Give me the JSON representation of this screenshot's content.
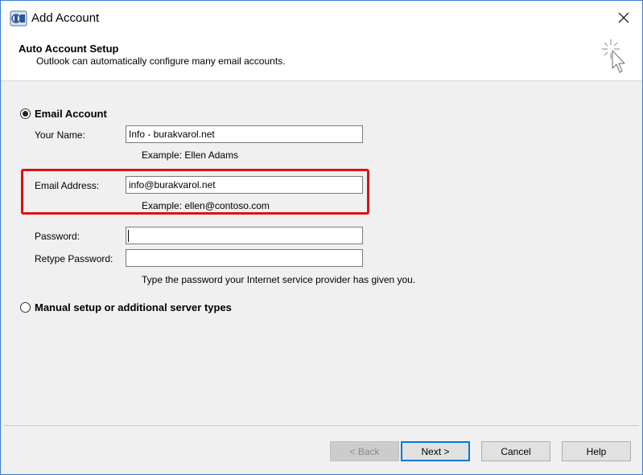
{
  "window": {
    "title": "Add Account",
    "close_glyph": "✕"
  },
  "header": {
    "title": "Auto Account Setup",
    "subtitle": "Outlook can automatically configure many email accounts."
  },
  "options": {
    "email_account": {
      "label": "Email Account",
      "selected": true
    },
    "manual_setup": {
      "label": "Manual setup or additional server types",
      "selected": false
    }
  },
  "form": {
    "name": {
      "label": "Your Name:",
      "value": "Info - burakvarol.net",
      "example": "Example: Ellen Adams"
    },
    "email": {
      "label": "Email Address:",
      "value": "info@burakvarol.net",
      "example": "Example: ellen@contoso.com"
    },
    "password": {
      "label": "Password:",
      "value": ""
    },
    "retype_password": {
      "label": "Retype Password:",
      "value": ""
    },
    "password_hint": "Type the password your Internet service provider has given you."
  },
  "buttons": {
    "back": "< Back",
    "next": "Next >",
    "cancel": "Cancel",
    "help": "Help"
  },
  "colors": {
    "highlight": "#e01010",
    "default_button_border": "#0078d7"
  },
  "icons": {
    "app": "outlook-app-icon",
    "close": "close-icon",
    "header": "magic-wand-cursor-icon"
  }
}
